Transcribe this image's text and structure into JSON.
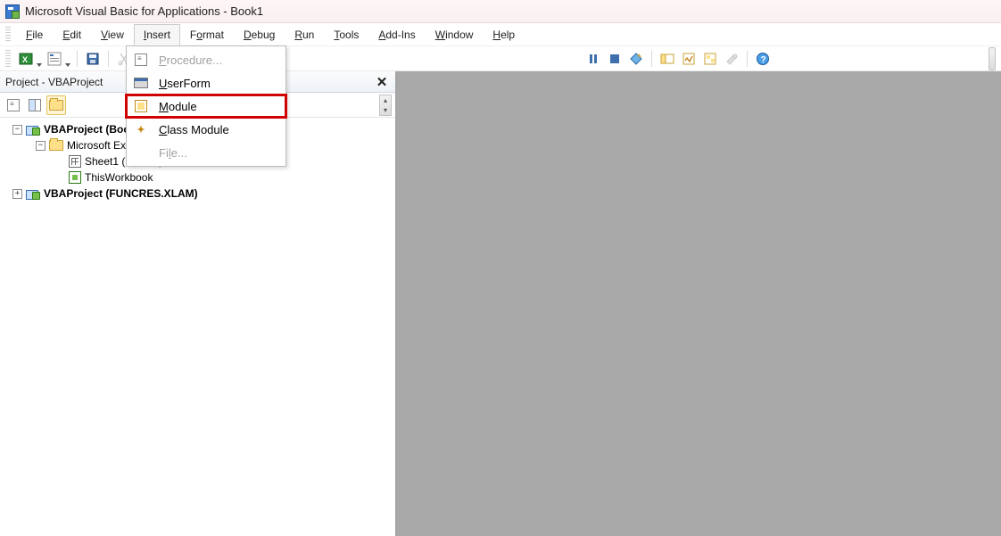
{
  "window": {
    "title": "Microsoft Visual Basic for Applications - Book1"
  },
  "menubar": {
    "file": {
      "label": "File",
      "key": "F"
    },
    "edit": {
      "label": "Edit",
      "key": "E"
    },
    "view": {
      "label": "View",
      "key": "V"
    },
    "insert": {
      "label": "Insert",
      "key": "I"
    },
    "format": {
      "label": "Format",
      "key": "o"
    },
    "debug": {
      "label": "Debug",
      "key": "D"
    },
    "run": {
      "label": "Run",
      "key": "R"
    },
    "tools": {
      "label": "Tools",
      "key": "T"
    },
    "addins": {
      "label": "Add-Ins",
      "key": "A"
    },
    "window": {
      "label": "Window",
      "key": "W"
    },
    "help": {
      "label": "Help",
      "key": "H"
    }
  },
  "insert_menu": {
    "procedure": {
      "label": "Procedure...",
      "key": "P",
      "enabled": false
    },
    "userform": {
      "label": "UserForm",
      "key": "U",
      "enabled": true
    },
    "module": {
      "label": "Module",
      "key": "M",
      "enabled": true,
      "highlighted": true
    },
    "classmodule": {
      "label": "Class Module",
      "key": "C",
      "enabled": true
    },
    "file": {
      "label": "File...",
      "key": "l",
      "enabled": false
    }
  },
  "project_panel": {
    "title": "Project - VBAProject",
    "tree": {
      "proj1": "VBAProject (Book1)",
      "ms_objects": "Microsoft Excel Objects",
      "sheet1": "Sheet1 (Sheet1)",
      "thiswb": "ThisWorkbook",
      "proj2": "VBAProject (FUNCRES.XLAM)"
    }
  }
}
